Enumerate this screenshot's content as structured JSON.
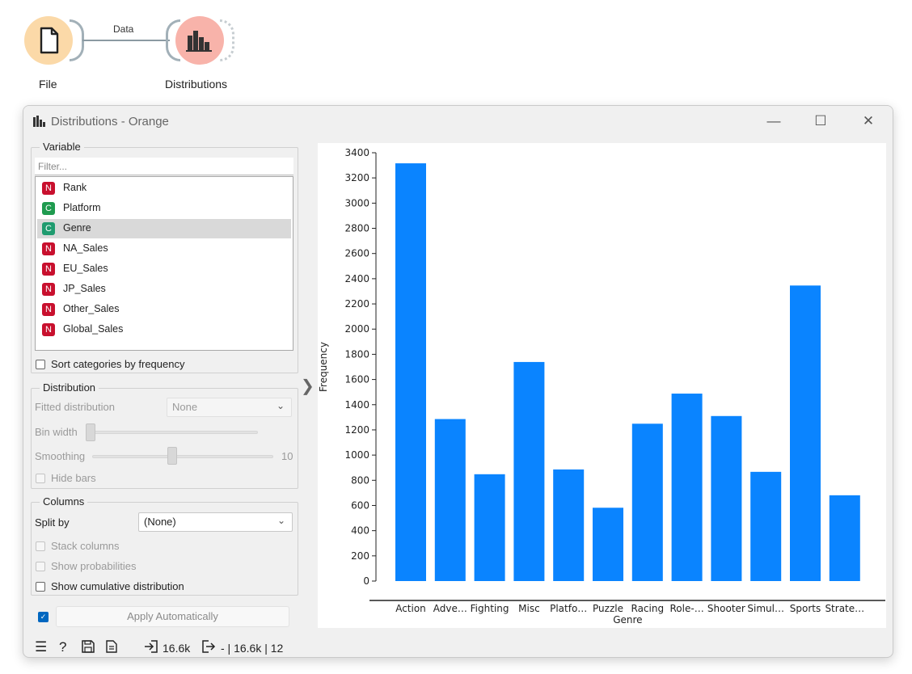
{
  "workflow": {
    "file_node_label": "File",
    "dist_node_label": "Distributions",
    "link_label": "Data"
  },
  "window": {
    "title": "Distributions - Orange"
  },
  "variable_box": {
    "title": "Variable",
    "filter_placeholder": "Filter...",
    "items": [
      {
        "type": "N",
        "name": "Rank",
        "color": "#c8102e"
      },
      {
        "type": "C",
        "name": "Platform",
        "color": "#1f9b4f"
      },
      {
        "type": "C",
        "name": "Genre",
        "color": "#1f9b6f",
        "selected": true
      },
      {
        "type": "N",
        "name": "NA_Sales",
        "color": "#c8102e"
      },
      {
        "type": "N",
        "name": "EU_Sales",
        "color": "#c8102e"
      },
      {
        "type": "N",
        "name": "JP_Sales",
        "color": "#c8102e"
      },
      {
        "type": "N",
        "name": "Other_Sales",
        "color": "#c8102e"
      },
      {
        "type": "N",
        "name": "Global_Sales",
        "color": "#c8102e"
      }
    ],
    "sort_label": "Sort categories by frequency"
  },
  "distribution_box": {
    "title": "Distribution",
    "fitted_label": "Fitted distribution",
    "fitted_value": "None",
    "bin_width_label": "Bin width",
    "smoothing_label": "Smoothing",
    "smoothing_value": "10",
    "hide_bars_label": "Hide bars"
  },
  "columns_box": {
    "title": "Columns",
    "split_label": "Split by",
    "split_value": "(None)",
    "stack_label": "Stack columns",
    "prob_label": "Show probabilities",
    "cumulative_label": "Show cumulative distribution"
  },
  "apply_label": "Apply Automatically",
  "status": {
    "input_count": "16.6k",
    "output_text": "- | 16.6k | 12"
  },
  "chart_data": {
    "type": "bar",
    "categories": [
      "Action",
      "Adve…",
      "Fighting",
      "Misc",
      "Platfo…",
      "Puzzle",
      "Racing",
      "Role-…",
      "Shooter",
      "Simul…",
      "Sports",
      "Strate…"
    ],
    "values": [
      3316,
      1286,
      848,
      1739,
      886,
      582,
      1249,
      1488,
      1310,
      867,
      2346,
      681
    ],
    "xlabel": "Genre",
    "ylabel": "Frequency",
    "ylim": [
      0,
      3400
    ],
    "yticks": [
      0,
      200,
      400,
      600,
      800,
      1000,
      1200,
      1400,
      1600,
      1800,
      2000,
      2200,
      2400,
      2600,
      2800,
      3000,
      3200,
      3400
    ],
    "bar_color": "#0a84ff",
    "grid": false
  }
}
